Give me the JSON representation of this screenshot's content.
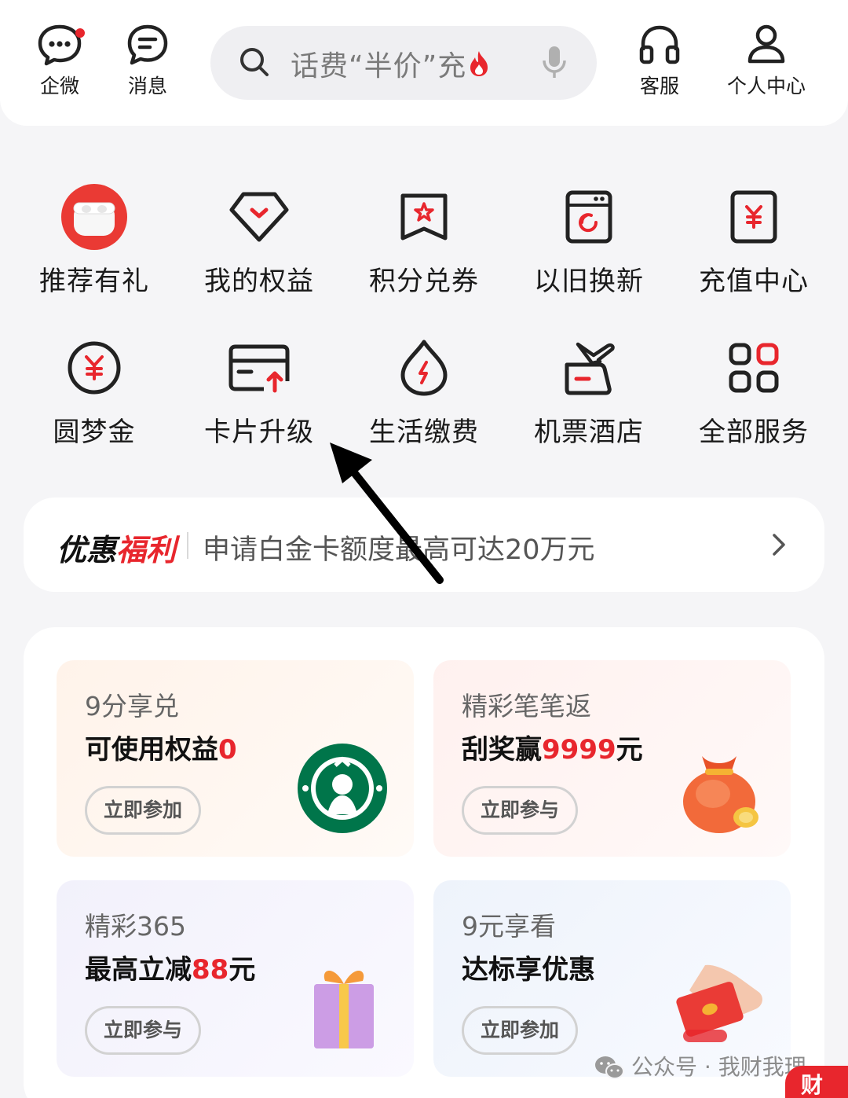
{
  "header": {
    "qiwei_label": "企微",
    "messages_label": "消息",
    "search_placeholder": "话费“半价”充",
    "service_label": "客服",
    "profile_label": "个人中心"
  },
  "services": [
    {
      "label": "推荐有礼",
      "icon": "airpods-gift-icon"
    },
    {
      "label": "我的权益",
      "icon": "diamond-icon"
    },
    {
      "label": "积分兑券",
      "icon": "star-bookmark-icon"
    },
    {
      "label": "以旧换新",
      "icon": "washing-machine-icon"
    },
    {
      "label": "充值中心",
      "icon": "yuan-card-icon"
    },
    {
      "label": "圆梦金",
      "icon": "yuan-coin-icon"
    },
    {
      "label": "卡片升级",
      "icon": "card-upgrade-icon"
    },
    {
      "label": "生活缴费",
      "icon": "drop-bolt-icon"
    },
    {
      "label": "机票酒店",
      "icon": "plane-luggage-icon"
    },
    {
      "label": "全部服务",
      "icon": "grid-icon"
    }
  ],
  "promo": {
    "title_black": "优惠",
    "title_red": "福利",
    "text": "申请白金卡额度最高可达20万元"
  },
  "cards": [
    {
      "sub": "9分享兑",
      "main": "可使用权益",
      "highlight": "0",
      "suffix": "",
      "button": "立即参加"
    },
    {
      "sub": "精彩笔笔返",
      "main": "刮奖赢",
      "highlight": "9999",
      "suffix": "元",
      "button": "立即参与"
    },
    {
      "sub": "精彩365",
      "main": "最高立减",
      "highlight": "88",
      "suffix": "元",
      "button": "立即参与"
    },
    {
      "sub": "9元享看",
      "main": "达标享优惠",
      "highlight": "",
      "suffix": "",
      "button": "立即参加"
    }
  ],
  "watermark": "公众号 · 我财我理",
  "corner_text": "财",
  "colors": {
    "accent": "#e8262d",
    "background": "#f5f5f7"
  }
}
